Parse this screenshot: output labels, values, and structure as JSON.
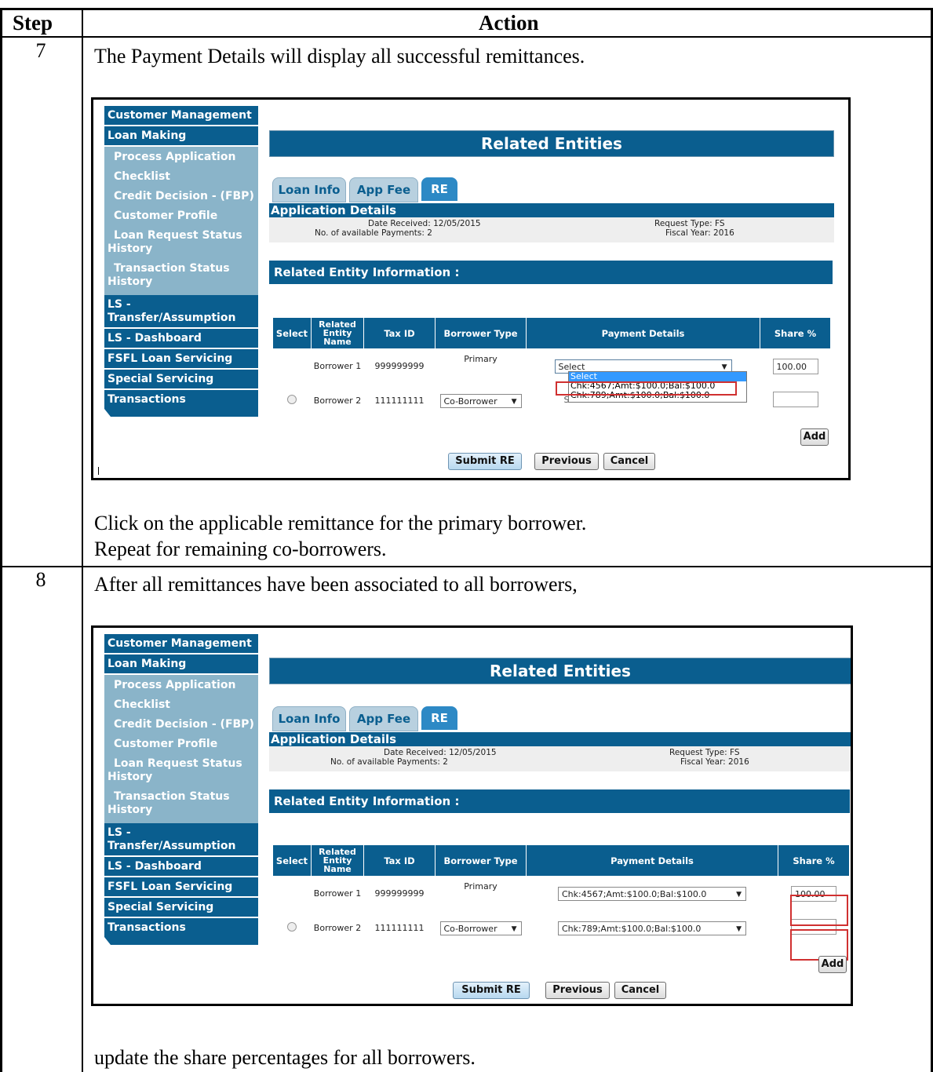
{
  "table": {
    "headers": {
      "step": "Step",
      "action": "Action"
    },
    "rows": [
      {
        "step": "7",
        "intro": "The Payment Details will display all successful remittances.",
        "outro_1": "Click on the applicable remittance for the primary borrower.",
        "outro_2": "Repeat for remaining co-borrowers."
      },
      {
        "step": "8",
        "intro": "After all remittances have been associated to all borrowers,",
        "outro_1": "update the share percentages for all borrowers."
      }
    ]
  },
  "screen": {
    "nav": {
      "customer_management": "Customer Management",
      "loan_making": "Loan Making",
      "sub_items": [
        "Process Application",
        "Checklist",
        "Credit Decision - (FBP)",
        "Customer Profile"
      ],
      "loan_request_status_1": "Loan Request Status",
      "loan_request_status_2": "History",
      "transaction_status_1": "Transaction Status",
      "transaction_status_2": "History",
      "ls_transfer_1": "LS -",
      "ls_transfer_2": "Transfer/Assumption",
      "ls_dashboard": "LS - Dashboard",
      "fsfl": "FSFL Loan Servicing",
      "special": "Special Servicing",
      "transactions": "Transactions"
    },
    "title": "Related Entities",
    "tabs": [
      "Loan Info",
      "App Fee",
      "RE"
    ],
    "app_details": {
      "heading": "Application Details",
      "date_received": "Date Received: 12/05/2015",
      "payments": "No. of available Payments: 2",
      "request_type": "Request Type: FS",
      "fiscal_year": "Fiscal Year: 2016"
    },
    "info_heading": "Related Entity Information :",
    "columns": {
      "select": "Select",
      "name_1": "Related",
      "name_2": "Entity",
      "name_3": "Name",
      "tax_id": "Tax ID",
      "borrower_type": "Borrower Type",
      "payment_details": "Payment Details",
      "share": "Share %"
    },
    "borrowers": [
      {
        "name": "Borrower 1",
        "tax_id": "999999999",
        "type": "Primary",
        "share": "100.00"
      },
      {
        "name": "Borrower 2",
        "tax_id": "111111111",
        "type": "Co-Borrower",
        "share": ""
      }
    ],
    "payment_select_default": "Select",
    "payment_options": [
      "Select",
      "Chk:4567;Amt:$100.0;Bal:$100.0",
      "Chk:789;Amt:$100.0;Bal:$100.0"
    ],
    "payment_obscured": "Select",
    "payment_selected": [
      "Chk:4567;Amt:$100.0;Bal:$100.0",
      "Chk:789;Amt:$100.0;Bal:$100.0"
    ],
    "buttons": {
      "add": "Add",
      "submit": "Submit RE",
      "previous": "Previous",
      "cancel": "Cancel"
    }
  },
  "colors": {
    "nav_blue": "#0a5e8f",
    "nav_light": "#8ab4c9",
    "highlight_red": "#d03030",
    "tab_active": "#2d89c5"
  }
}
